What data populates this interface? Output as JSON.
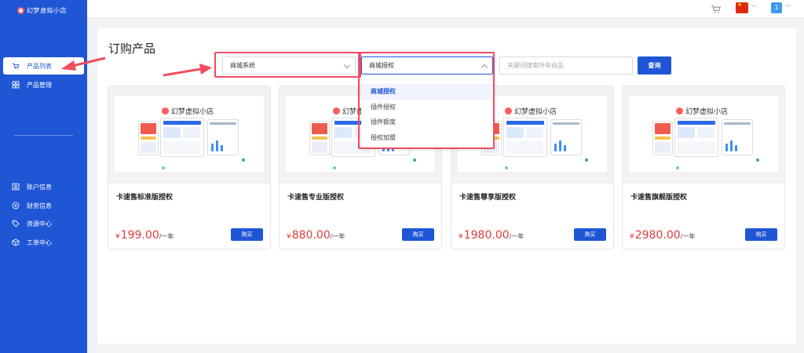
{
  "app": {
    "logo_text": "幻梦虚拟小店"
  },
  "sidebar": {
    "items": [
      {
        "label": "产品列表",
        "icon": "cart-icon"
      },
      {
        "label": "产品管理",
        "icon": "grid-icon"
      },
      {
        "label": "账户信息",
        "icon": "user-card-icon"
      },
      {
        "label": "财务信息",
        "icon": "money-icon"
      },
      {
        "label": "资源中心",
        "icon": "tag-icon"
      },
      {
        "label": "工单中心",
        "icon": "box-icon"
      }
    ]
  },
  "header": {
    "avatar_label": "1"
  },
  "page": {
    "title": "订购产品"
  },
  "filters": {
    "category_value": "商城系统",
    "type_value": "商城授权",
    "type_options": [
      "商城授权",
      "插件授权",
      "插件额度",
      "授权加盟"
    ],
    "search_placeholder": "关键词搜索所有商品",
    "query_label": "查询"
  },
  "products": [
    {
      "name": "卡速售标准版授权",
      "currency": "¥",
      "price": "199.00",
      "period": "/一年",
      "buy_label": "购买",
      "thumb_logo": "幻梦虚拟小店"
    },
    {
      "name": "卡速售专业版授权",
      "currency": "¥",
      "price": "880.00",
      "period": "/一年",
      "buy_label": "购买",
      "thumb_logo": "幻梦虚拟小店"
    },
    {
      "name": "卡速售尊享版授权",
      "currency": "¥",
      "price": "1980.00",
      "period": "/一年",
      "buy_label": "购买",
      "thumb_logo": "幻梦虚拟小店"
    },
    {
      "name": "卡速售旗舰版授权",
      "currency": "¥",
      "price": "2980.00",
      "period": "/一年",
      "buy_label": "购买",
      "thumb_logo": "幻梦虚拟小店"
    }
  ],
  "colors": {
    "brand": "#1f56d6",
    "price": "#e03a3a",
    "highlight": "#f24b5e"
  }
}
